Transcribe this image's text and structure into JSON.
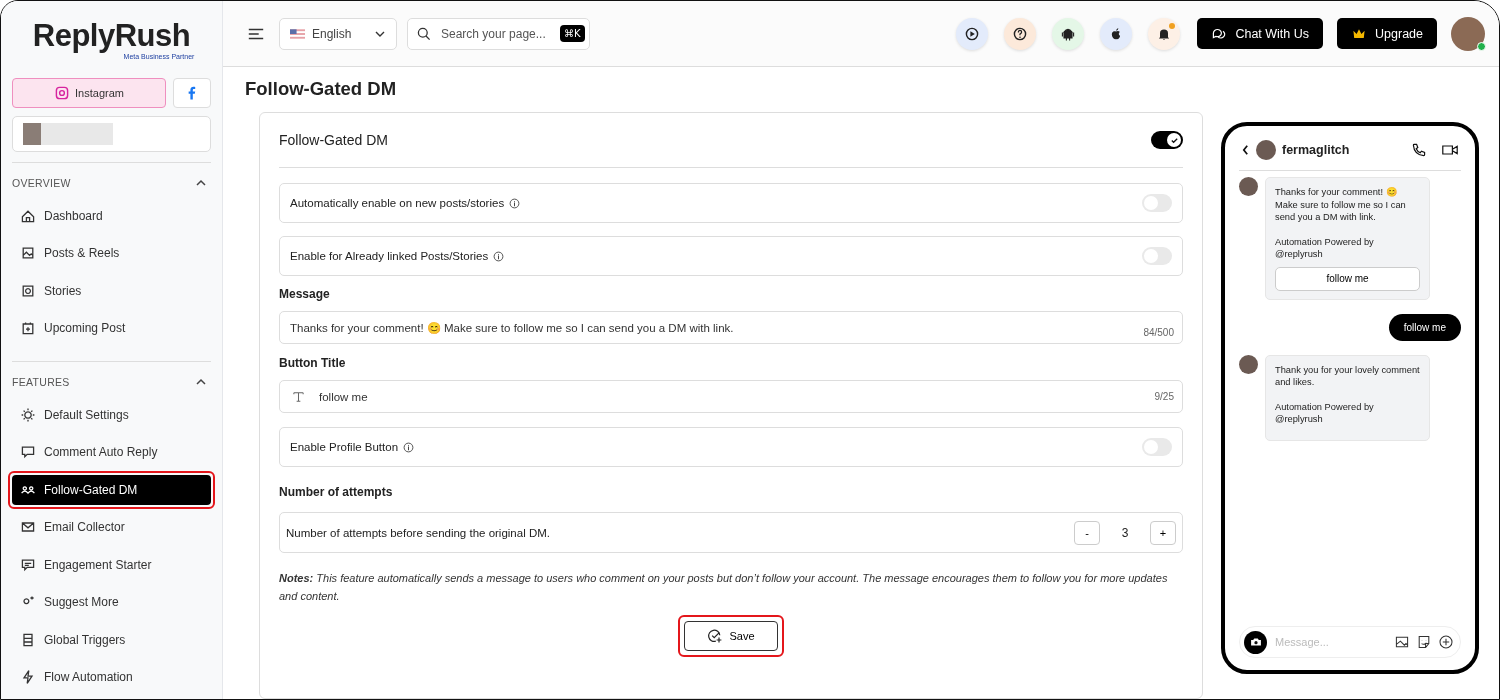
{
  "brand": {
    "name": "ReplyRush",
    "tagline": "Meta Business Partner"
  },
  "platform_tabs": [
    {
      "kind": "instagram",
      "label": "Instagram",
      "selected": true
    },
    {
      "kind": "facebook",
      "selected": false
    }
  ],
  "nav_sections": [
    {
      "title": "OVERVIEW",
      "expanded": true,
      "items": [
        {
          "label": "Dashboard",
          "selected": false
        },
        {
          "label": "Posts & Reels",
          "selected": false
        },
        {
          "label": "Stories",
          "selected": false
        },
        {
          "label": "Upcoming Post",
          "selected": false
        }
      ]
    },
    {
      "title": "FEATURES",
      "expanded": true,
      "items": [
        {
          "label": "Default Settings",
          "selected": false
        },
        {
          "label": "Comment Auto Reply",
          "selected": false
        },
        {
          "label": "Follow-Gated DM",
          "selected": true,
          "highlighted": true
        },
        {
          "label": "Email Collector",
          "selected": false
        },
        {
          "label": "Engagement Starter",
          "selected": false
        },
        {
          "label": "Suggest More",
          "selected": false
        },
        {
          "label": "Global Triggers",
          "selected": false
        },
        {
          "label": "Flow Automation",
          "selected": false
        }
      ]
    }
  ],
  "header": {
    "language": "English",
    "search": {
      "placeholder": "Search your page...",
      "shortcut": "⌘K"
    },
    "notification_dot": true,
    "buttons": [
      "Chat With Us",
      "Upgrade"
    ],
    "online": true
  },
  "page_title": "Follow-Gated DM",
  "card": {
    "title": "Follow-Gated DM",
    "on": true,
    "toggles": [
      {
        "label": "Automatically enable on new posts/stories",
        "on": false
      },
      {
        "label": "Enable for Already linked Posts/Stories",
        "on": false
      }
    ],
    "message": {
      "label": "Message",
      "value": "Thanks for your comment! 😊 Make sure to follow me so I can send you a DM with link.",
      "count": "84/500"
    },
    "button_title": {
      "label": "Button Title",
      "value": "follow me",
      "count": "9/25"
    },
    "profile_toggle": {
      "label": "Enable Profile Button",
      "on": false
    },
    "attempts": {
      "label": "Number of attempts",
      "description": "Number of attempts before sending the original DM.",
      "minus": "-",
      "value": "3",
      "plus": "+"
    },
    "notes": "**Notes:** This feature automatically sends a message to users who comment on your posts but don’t follow your account. The message encourages them to follow you for more updates and content.",
    "save": {
      "label": "Save",
      "highlighted": true
    }
  },
  "phone": {
    "username": "fermaglitch",
    "messages": [
      {
        "kind": "incoming",
        "text": "Thanks for your comment! 😊 Make sure to follow me so I can send you a DM with link.",
        "footer": "Automation Powered by @replyrush",
        "button": "follow me"
      },
      {
        "kind": "outgoing",
        "text": "follow me"
      },
      {
        "kind": "incoming",
        "text": "Thank you for your lovely comment and likes.",
        "footer": "Automation Powered by @replyrush"
      }
    ],
    "composer_placeholder": "Message..."
  }
}
